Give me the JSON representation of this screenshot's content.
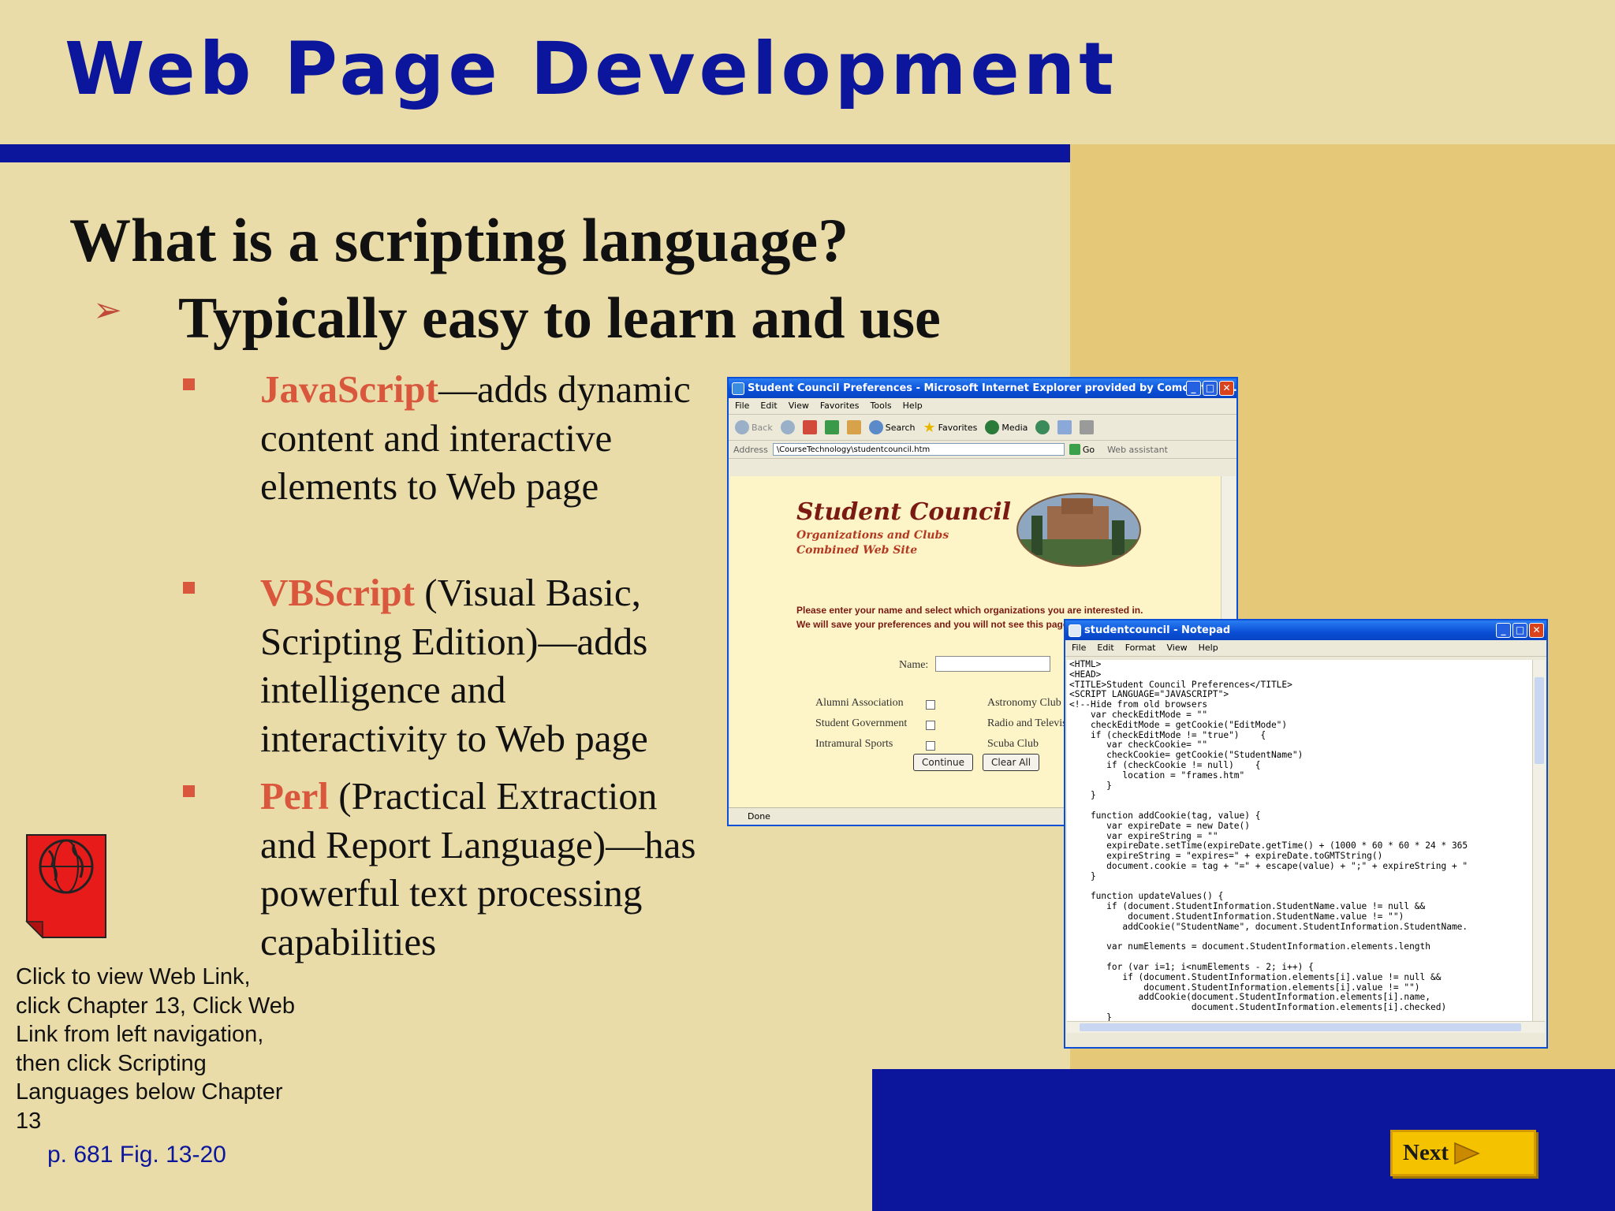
{
  "slide": {
    "title": "Web Page Development",
    "heading": "What is a scripting language?",
    "bullet": "Typically easy to learn and use",
    "sub_bullets": [
      {
        "highlight": "JavaScript",
        "rest": "—adds dynamic content and interactive elements to Web page"
      },
      {
        "highlight": "VBScript",
        "rest": " (Visual Basic, Scripting Edition)—adds intelligence and interactivity to Web page"
      },
      {
        "highlight": "Perl",
        "rest": " (Practical Extraction and Report Language)—has powerful text processing capabilities"
      }
    ],
    "note": "Click to view Web Link, click Chapter 13, Click Web Link from left navigation, then click Scripting Languages below Chapter 13",
    "page_ref": "p. 681 Fig. 13-20",
    "next_label": "Next"
  },
  "ie": {
    "title": "Student Council Preferences - Microsoft Internet Explorer provided by Comcast Hig...",
    "menu": [
      "File",
      "Edit",
      "View",
      "Favorites",
      "Tools",
      "Help"
    ],
    "toolbar": {
      "back": "Back",
      "search": "Search",
      "favorites": "Favorites",
      "media": "Media"
    },
    "address_label": "Address",
    "address_value": "\\CourseTechnology\\studentcouncil.htm",
    "go_label": "Go",
    "web_assistant": "Web assistant",
    "status": "Done",
    "page": {
      "title": "Student Council",
      "subtitle_line1": "Organizations and Clubs",
      "subtitle_line2": "Combined Web Site",
      "instructions_line1": "Please enter your name and select which organizations you are interested in.",
      "instructions_line2": "We will save your preferences and you will not see this page on your next visit.",
      "name_label": "Name:",
      "orgs_left": [
        "Alumni Association",
        "Student Government",
        "Intramural Sports"
      ],
      "orgs_right": [
        "Astronomy Club",
        "Radio and Television",
        "Scuba Club"
      ],
      "continue_label": "Continue",
      "clear_label": "Clear All"
    }
  },
  "notepad": {
    "title": "studentcouncil - Notepad",
    "menu": [
      "File",
      "Edit",
      "Format",
      "View",
      "Help"
    ],
    "code": [
      "<HTML>",
      "<HEAD>",
      "<TITLE>Student Council Preferences</TITLE>",
      "<SCRIPT LANGUAGE=\"JAVASCRIPT\">",
      "<!--Hide from old browsers",
      "    var checkEditMode = \"\"",
      "    checkEditMode = getCookie(\"EditMode\")",
      "    if (checkEditMode != \"true\")    {",
      "       var checkCookie= \"\"",
      "       checkCookie= getCookie(\"StudentName\")",
      "       if (checkCookie != null)    {",
      "          location = \"frames.htm\"",
      "       }",
      "    }",
      "",
      "    function addCookie(tag, value) {",
      "       var expireDate = new Date()",
      "       var expireString = \"\"",
      "       expireDate.setTime(expireDate.getTime() + (1000 * 60 * 60 * 24 * 365",
      "       expireString = \"expires=\" + expireDate.toGMTString()",
      "       document.cookie = tag + \"=\" + escape(value) + \";\" + expireString + \"",
      "    }",
      "",
      "    function updateValues() {",
      "       if (document.StudentInformation.StudentName.value != null &&",
      "           document.StudentInformation.StudentName.value != \"\")",
      "          addCookie(\"StudentName\", document.StudentInformation.StudentName.",
      "",
      "       var numElements = document.StudentInformation.elements.length",
      "",
      "       for (var i=1; i<numElements - 2; i++) {",
      "          if (document.StudentInformation.elements[i].value != null &&",
      "              document.StudentInformation.elements[i].value != \"\")",
      "             addCookie(document.StudentInformation.elements[i].name,",
      "                       document.StudentInformation.elements[i].checked)",
      "       }",
      "    }"
    ]
  },
  "colors": {
    "title_blue": "#0b169c",
    "accent_red": "#d9573c",
    "next_yellow": "#f5c200",
    "background": "#e9dca8"
  }
}
